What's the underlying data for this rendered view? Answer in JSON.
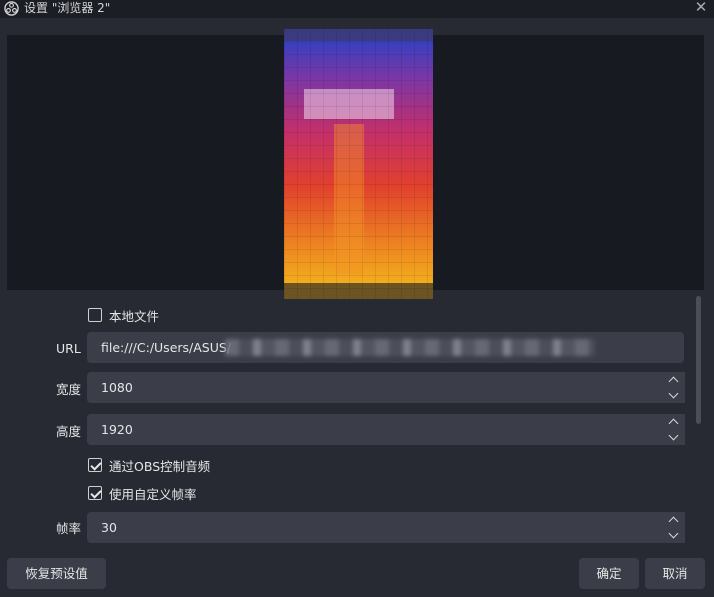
{
  "window": {
    "title": "设置 \"浏览器 2\"",
    "app_icon": "obs-icon",
    "close_icon": "close-icon"
  },
  "properties": {
    "local_file": {
      "label": "本地文件",
      "checked": false
    },
    "url": {
      "label": "URL",
      "value": "file:///C:/Users/ASUS/"
    },
    "width": {
      "label": "宽度",
      "value": "1080"
    },
    "height": {
      "label": "高度",
      "value": "1920"
    },
    "control_audio": {
      "label": "通过OBS控制音频",
      "checked": true
    },
    "custom_fps": {
      "label": "使用自定义帧率",
      "checked": true
    },
    "fps": {
      "label": "帧率",
      "value": "30"
    }
  },
  "footer": {
    "restore_defaults": "恢复预设值",
    "ok": "确定",
    "cancel": "取消"
  }
}
